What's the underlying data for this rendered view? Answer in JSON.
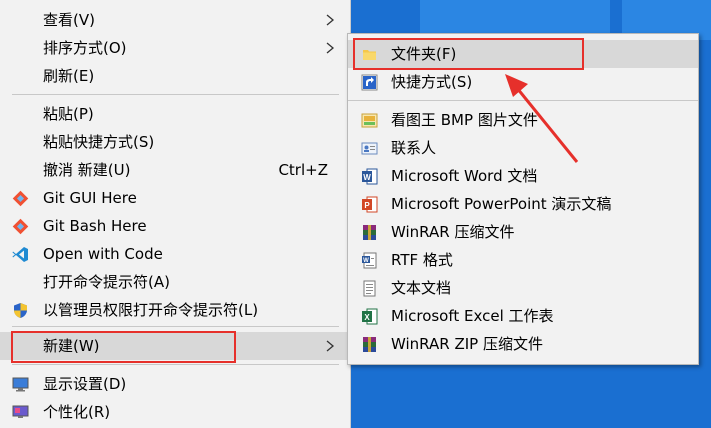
{
  "menu": {
    "items": [
      {
        "label": "查看(V)",
        "icon": "view-icon",
        "submenu": true
      },
      {
        "label": "排序方式(O)",
        "icon": "",
        "submenu": true
      },
      {
        "label": "刷新(E)",
        "icon": ""
      },
      {
        "label": "粘贴(P)",
        "icon": ""
      },
      {
        "label": "粘贴快捷方式(S)",
        "icon": ""
      },
      {
        "label": "撤消 新建(U)",
        "icon": "",
        "shortcut": "Ctrl+Z"
      },
      {
        "label": "Git GUI Here",
        "icon": "git-gui-icon"
      },
      {
        "label": "Git Bash Here",
        "icon": "git-bash-icon"
      },
      {
        "label": "Open with Code",
        "icon": "vscode-icon"
      },
      {
        "label": "打开命令提示符(A)",
        "icon": ""
      },
      {
        "label": "以管理员权限打开命令提示符(L)",
        "icon": "uac-shield-icon"
      },
      {
        "label": "新建(W)",
        "icon": "",
        "submenu": true,
        "highlighted": true
      },
      {
        "label": "显示设置(D)",
        "icon": "display-settings-icon"
      },
      {
        "label": "个性化(R)",
        "icon": "personalize-icon"
      }
    ]
  },
  "submenu": {
    "items": [
      {
        "label": "文件夹(F)",
        "icon": "folder-icon",
        "highlighted": true
      },
      {
        "label": "快捷方式(S)",
        "icon": "shortcut-icon"
      },
      {
        "label": "看图王 BMP 图片文件",
        "icon": "bmp-image-icon"
      },
      {
        "label": "联系人",
        "icon": "contact-icon"
      },
      {
        "label": "Microsoft Word 文档",
        "icon": "word-icon"
      },
      {
        "label": "Microsoft PowerPoint 演示文稿",
        "icon": "powerpoint-icon"
      },
      {
        "label": "WinRAR 压缩文件",
        "icon": "winrar-icon"
      },
      {
        "label": "RTF 格式",
        "icon": "rtf-icon"
      },
      {
        "label": "文本文档",
        "icon": "text-doc-icon"
      },
      {
        "label": "Microsoft Excel 工作表",
        "icon": "excel-icon"
      },
      {
        "label": "WinRAR ZIP 压缩文件",
        "icon": "winrar-zip-icon"
      }
    ]
  },
  "colors": {
    "highlight": "#d8d8d8",
    "annotation": "#e6302b",
    "desktop": "#1a6fd1"
  }
}
